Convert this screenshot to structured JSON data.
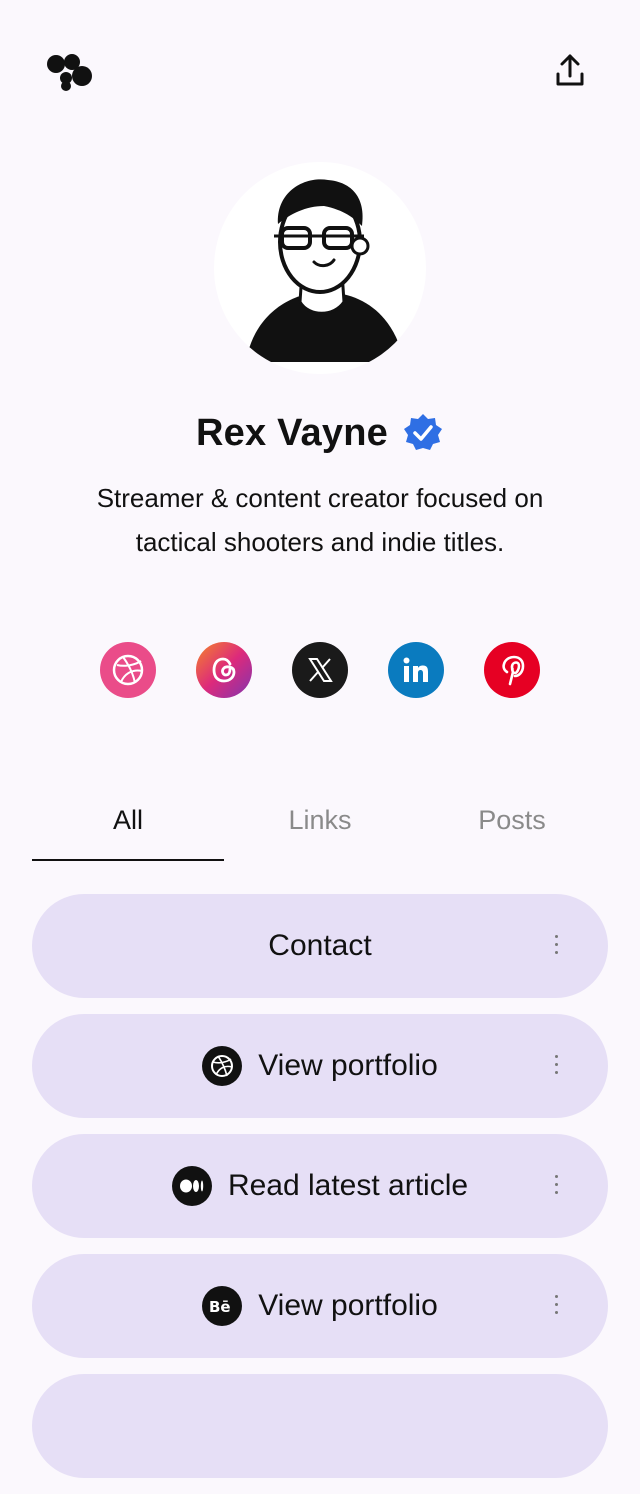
{
  "profile": {
    "name": "Rex Vayne",
    "bio": "Streamer & content creator focused on tactical shooters and indie titles."
  },
  "socials": [
    {
      "icon": "dribbble-icon",
      "color": "#ea4c89"
    },
    {
      "icon": "threads-icon",
      "color": "#c13584"
    },
    {
      "icon": "x-icon",
      "color": "#1a1a1a"
    },
    {
      "icon": "linkedin-icon",
      "color": "#0a7bbf"
    },
    {
      "icon": "pinterest-icon",
      "color": "#e60023"
    }
  ],
  "tabs": [
    {
      "label": "All",
      "active": true
    },
    {
      "label": "Links",
      "active": false
    },
    {
      "label": "Posts",
      "active": false
    }
  ],
  "cards": [
    {
      "label": "Contact",
      "icon": null
    },
    {
      "label": "View portfolio",
      "icon": "dribbble-icon"
    },
    {
      "label": "Read latest article",
      "icon": "medium-icon"
    },
    {
      "label": "View portfolio",
      "icon": "behance-icon"
    }
  ],
  "colors": {
    "background": "#fbf8fd",
    "card": "#e6dff6",
    "verified": "#2f6fe4"
  }
}
